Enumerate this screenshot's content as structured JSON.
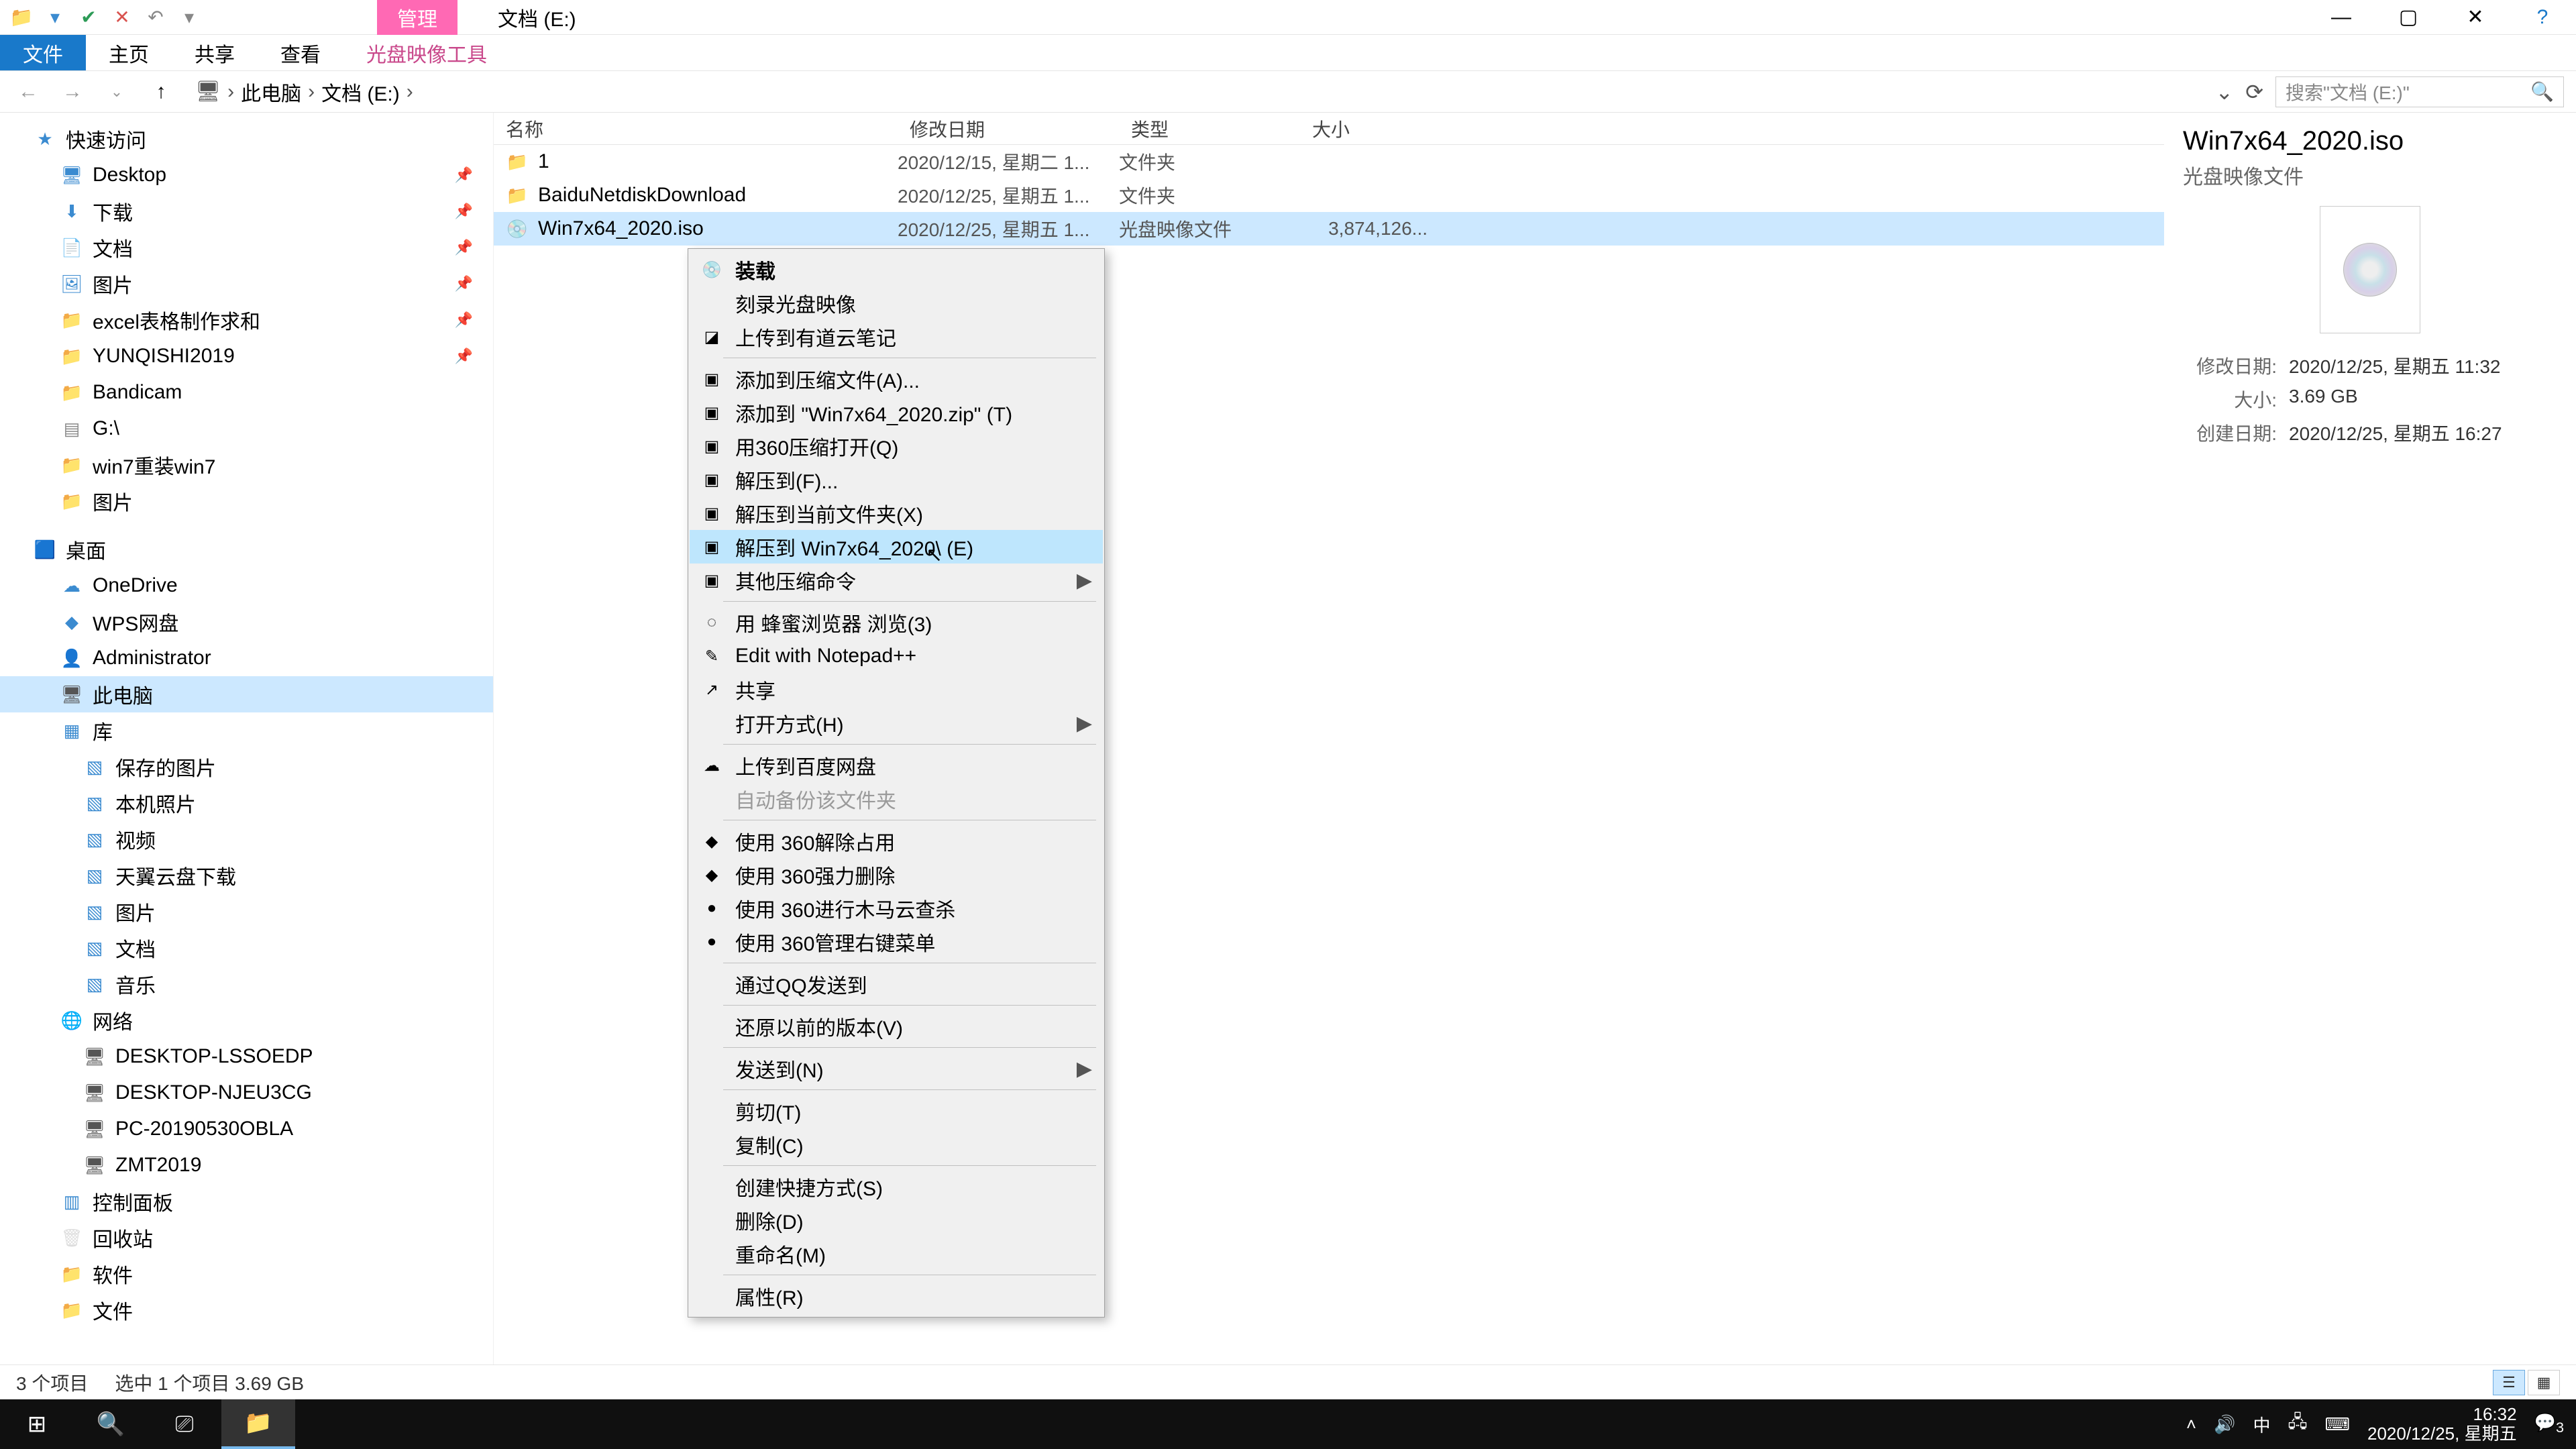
{
  "titlebar": {
    "context_tab": "管理",
    "window_title": "文档 (E:)",
    "min": "—",
    "max": "▢",
    "close": "✕",
    "help": "?"
  },
  "ribbon": {
    "file": "文件",
    "home": "主页",
    "share": "共享",
    "view": "查看",
    "context_tool": "光盘映像工具"
  },
  "addr": {
    "back": "←",
    "fwd": "→",
    "up": "↑",
    "root": "此电脑",
    "current": "文档 (E:)",
    "sep": "›",
    "dropdown": "⌄",
    "refresh": "⟳",
    "search_placeholder": "搜索\"文档 (E:)\"",
    "search_icon": "🔍"
  },
  "nav": {
    "quick": "快速访问",
    "items_quick": [
      {
        "label": "Desktop",
        "ico": "🖥",
        "color": "ico-blue",
        "pin": true
      },
      {
        "label": "下载",
        "ico": "⬇",
        "color": "ico-blue",
        "pin": true
      },
      {
        "label": "文档",
        "ico": "📄",
        "color": "ico-blue",
        "pin": true
      },
      {
        "label": "图片",
        "ico": "🖼",
        "color": "ico-blue",
        "pin": true
      },
      {
        "label": "excel表格制作求和",
        "ico": "📁",
        "color": "ico-folder",
        "pin": true
      },
      {
        "label": "YUNQISHI2019",
        "ico": "📁",
        "color": "ico-folder",
        "pin": true
      },
      {
        "label": "Bandicam",
        "ico": "📁",
        "color": "ico-folder"
      },
      {
        "label": "G:\\",
        "ico": "▤",
        "color": "ico-drive"
      },
      {
        "label": "win7重装win7",
        "ico": "📁",
        "color": "ico-folder"
      },
      {
        "label": "图片",
        "ico": "📁",
        "color": "ico-folder"
      }
    ],
    "desktop_hdr": "桌面",
    "items_desktop": [
      {
        "label": "OneDrive",
        "ico": "☁",
        "color": "ico-blue"
      },
      {
        "label": "WPS网盘",
        "ico": "◆",
        "color": "ico-blue"
      },
      {
        "label": "Administrator",
        "ico": "👤",
        "color": "ico-green"
      },
      {
        "label": "此电脑",
        "ico": "🖥",
        "color": "ico-pc",
        "selected": true
      },
      {
        "label": "库",
        "ico": "▦",
        "color": "ico-blue"
      }
    ],
    "items_lib": [
      {
        "label": "保存的图片",
        "ico": "▧",
        "color": "ico-blue"
      },
      {
        "label": "本机照片",
        "ico": "▧",
        "color": "ico-blue"
      },
      {
        "label": "视频",
        "ico": "▧",
        "color": "ico-blue"
      },
      {
        "label": "天翼云盘下载",
        "ico": "▧",
        "color": "ico-blue"
      },
      {
        "label": "图片",
        "ico": "▧",
        "color": "ico-blue"
      },
      {
        "label": "文档",
        "ico": "▧",
        "color": "ico-blue"
      },
      {
        "label": "音乐",
        "ico": "▧",
        "color": "ico-blue"
      }
    ],
    "network_hdr": "网络",
    "items_net": [
      {
        "label": "DESKTOP-LSSOEDP",
        "ico": "🖥",
        "color": "ico-pc"
      },
      {
        "label": "DESKTOP-NJEU3CG",
        "ico": "🖥",
        "color": "ico-pc"
      },
      {
        "label": "PC-20190530OBLA",
        "ico": "🖥",
        "color": "ico-pc"
      },
      {
        "label": "ZMT2019",
        "ico": "🖥",
        "color": "ico-pc"
      }
    ],
    "items_misc": [
      {
        "label": "控制面板",
        "ico": "▥",
        "color": "ico-blue"
      },
      {
        "label": "回收站",
        "ico": "🗑",
        "color": "ico-white"
      },
      {
        "label": "软件",
        "ico": "📁",
        "color": "ico-folder"
      },
      {
        "label": "文件",
        "ico": "📁",
        "color": "ico-folder"
      }
    ]
  },
  "cols": {
    "name": "名称",
    "date": "修改日期",
    "type": "类型",
    "size": "大小"
  },
  "rows": [
    {
      "ico": "📁",
      "cls": "ico-folder",
      "name": "1",
      "date": "2020/12/15, 星期二 1...",
      "type": "文件夹",
      "size": ""
    },
    {
      "ico": "📁",
      "cls": "ico-folder",
      "name": "BaiduNetdiskDownload",
      "date": "2020/12/25, 星期五 1...",
      "type": "文件夹",
      "size": ""
    },
    {
      "ico": "💿",
      "cls": "ico-disc",
      "name": "Win7x64_2020.iso",
      "date": "2020/12/25, 星期五 1...",
      "type": "光盘映像文件",
      "size": "3,874,126...",
      "selected": true
    }
  ],
  "details": {
    "title": "Win7x64_2020.iso",
    "type": "光盘映像文件",
    "props": [
      {
        "k": "修改日期:",
        "v": "2020/12/25, 星期五 11:32"
      },
      {
        "k": "大小:",
        "v": "3.69 GB"
      },
      {
        "k": "创建日期:",
        "v": "2020/12/25, 星期五 16:27"
      }
    ]
  },
  "status": {
    "count": "3 个项目",
    "selection": "选中 1 个项目  3.69 GB"
  },
  "ctx": {
    "items": [
      {
        "label": "装载",
        "ico": "💿",
        "bold": true
      },
      {
        "label": "刻录光盘映像"
      },
      {
        "label": "上传到有道云笔记",
        "ico": "◪"
      },
      {
        "sep": true
      },
      {
        "label": "添加到压缩文件(A)...",
        "ico": "▣"
      },
      {
        "label": "添加到 \"Win7x64_2020.zip\" (T)",
        "ico": "▣"
      },
      {
        "label": "用360压缩打开(Q)",
        "ico": "▣"
      },
      {
        "label": "解压到(F)...",
        "ico": "▣"
      },
      {
        "label": "解压到当前文件夹(X)",
        "ico": "▣"
      },
      {
        "label": "解压到 Win7x64_2020\\ (E)",
        "ico": "▣",
        "hover": true
      },
      {
        "label": "其他压缩命令",
        "ico": "▣",
        "arrow": true
      },
      {
        "sep": true
      },
      {
        "label": "用 蜂蜜浏览器 浏览(3)",
        "ico": "◌"
      },
      {
        "label": "Edit with Notepad++",
        "ico": "✎"
      },
      {
        "label": "共享",
        "ico": "↗"
      },
      {
        "label": "打开方式(H)",
        "arrow": true
      },
      {
        "sep": true
      },
      {
        "label": "上传到百度网盘",
        "ico": "☁"
      },
      {
        "label": "自动备份该文件夹",
        "disabled": true
      },
      {
        "sep": true
      },
      {
        "label": "使用 360解除占用",
        "ico": "◆"
      },
      {
        "label": "使用 360强力删除",
        "ico": "◆"
      },
      {
        "label": "使用 360进行木马云查杀",
        "ico": "●"
      },
      {
        "label": "使用 360管理右键菜单",
        "ico": "●"
      },
      {
        "sep": true
      },
      {
        "label": "通过QQ发送到"
      },
      {
        "sep": true
      },
      {
        "label": "还原以前的版本(V)"
      },
      {
        "sep": true
      },
      {
        "label": "发送到(N)",
        "arrow": true
      },
      {
        "sep": true
      },
      {
        "label": "剪切(T)"
      },
      {
        "label": "复制(C)"
      },
      {
        "sep": true
      },
      {
        "label": "创建快捷方式(S)"
      },
      {
        "label": "删除(D)"
      },
      {
        "label": "重命名(M)"
      },
      {
        "sep": true
      },
      {
        "label": "属性(R)"
      }
    ]
  },
  "taskbar": {
    "time": "16:32",
    "date": "2020/12/25, 星期五",
    "badge": "3",
    "ime": "中"
  }
}
